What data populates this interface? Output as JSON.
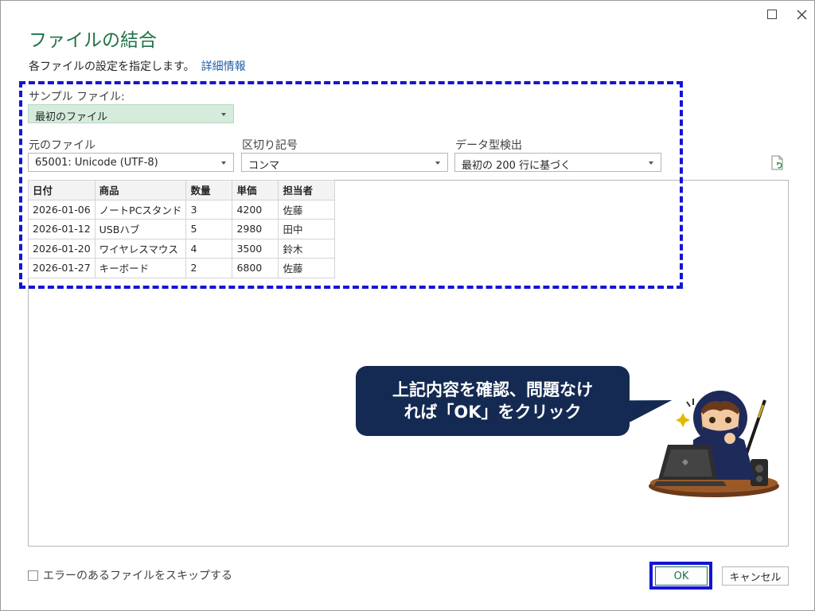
{
  "window": {
    "maximize_icon": "maximize-icon",
    "close_icon": "close-icon"
  },
  "dialog": {
    "title": "ファイルの結合",
    "subtitle": "各ファイルの設定を指定します。",
    "details_link": "詳細情報"
  },
  "sample_file": {
    "label": "サンプル ファイル:",
    "value": "最初のファイル"
  },
  "source_file": {
    "label": "元のファイル",
    "value": "65001: Unicode (UTF-8)"
  },
  "delimiter": {
    "label": "区切り記号",
    "value": "コンマ"
  },
  "data_type_detection": {
    "label": "データ型検出",
    "value": "最初の 200 行に基づく"
  },
  "table": {
    "columns": [
      "日付",
      "商品",
      "数量",
      "単価",
      "担当者"
    ],
    "rows": [
      [
        "2026-01-06",
        "ノートPCスタンド",
        "3",
        "4200",
        "佐藤"
      ],
      [
        "2026-01-12",
        "USBハブ",
        "5",
        "2980",
        "田中"
      ],
      [
        "2026-01-20",
        "ワイヤレスマウス",
        "4",
        "3500",
        "鈴木"
      ],
      [
        "2026-01-27",
        "キーボード",
        "2",
        "6800",
        "佐藤"
      ]
    ]
  },
  "callout": {
    "line1": "上記内容を確認、問題なけ",
    "line2": "れば「OK」をクリック"
  },
  "footer": {
    "skip_errors_label": "エラーのあるファイルをスキップする",
    "ok_label": "OK",
    "cancel_label": "キャンセル"
  },
  "colors": {
    "title_green": "#217346",
    "highlight_blue": "#1414d6",
    "callout_navy": "#142a52",
    "sample_select_green": "#d5ebdc",
    "link_blue": "#1f5fa8"
  }
}
